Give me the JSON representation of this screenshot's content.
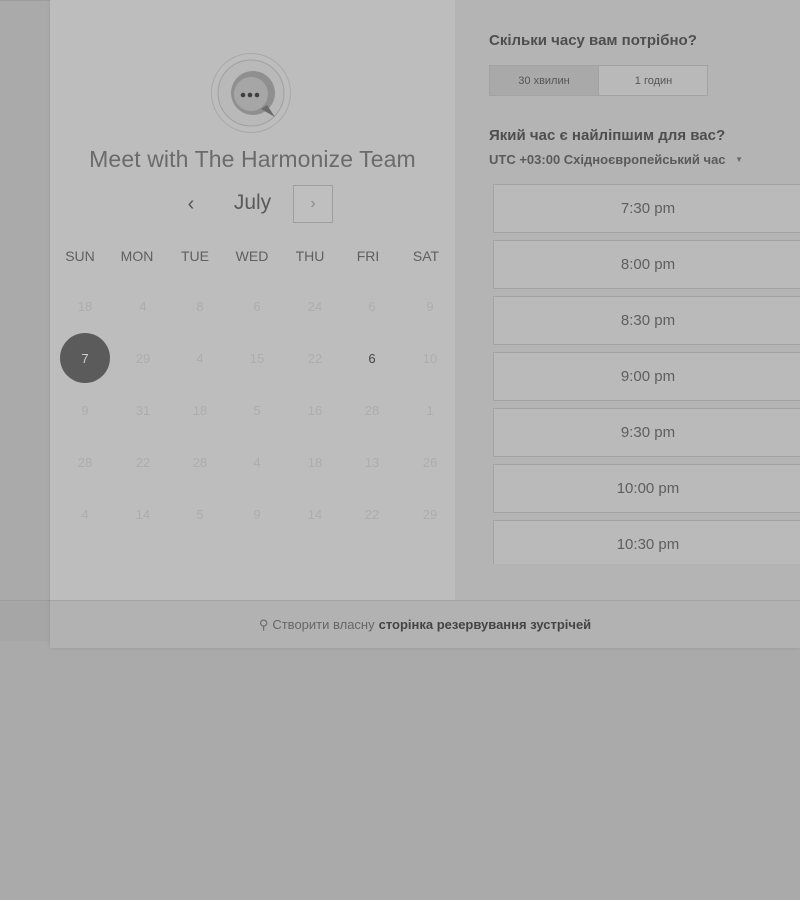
{
  "left": {
    "logo_icon": "chat-bubble-icon",
    "team_name": "Meet with The Harmonize Team",
    "month": "July",
    "prev_icon": "‹",
    "next_icon": "›",
    "weekdays": [
      "SUN",
      "MON",
      "TUE",
      "WED",
      "THU",
      "FRI",
      "SAT"
    ],
    "weeks": [
      [
        "18",
        "4",
        "8",
        "6",
        "24",
        "6",
        "9"
      ],
      [
        "7",
        "29",
        "4",
        "15",
        "22",
        "6",
        "10"
      ],
      [
        "9",
        "31",
        "18",
        "5",
        "16",
        "28",
        "1"
      ],
      [
        "28",
        "22",
        "28",
        "4",
        "18",
        "13",
        "26"
      ],
      [
        "4",
        "14",
        "5",
        "9",
        "14",
        "22",
        "29"
      ]
    ],
    "selected_day": "7",
    "available_day": "6"
  },
  "right": {
    "duration_question": "Скільки часу вам потрібно?",
    "durations": [
      "30 хвилин",
      "1 годин"
    ],
    "selected_duration": "30 хвилин",
    "time_question": "Який час є найліпшим для вас?",
    "timezone_offset": "UTC +03:00",
    "timezone_name": "Східноєвропейський час",
    "slots": [
      "7:30 pm",
      "8:00 pm",
      "8:30 pm",
      "9:00 pm",
      "9:30 pm",
      "10:00 pm",
      "10:30 pm"
    ]
  },
  "footer": {
    "icon": "hubspot-sprocket-icon",
    "prefix": "Створити власну",
    "link": "сторінка резервування зустрічей"
  },
  "colors": {
    "selected_day_bg": "#5b5b5b",
    "overlay_tint": "#aaaaaa"
  }
}
